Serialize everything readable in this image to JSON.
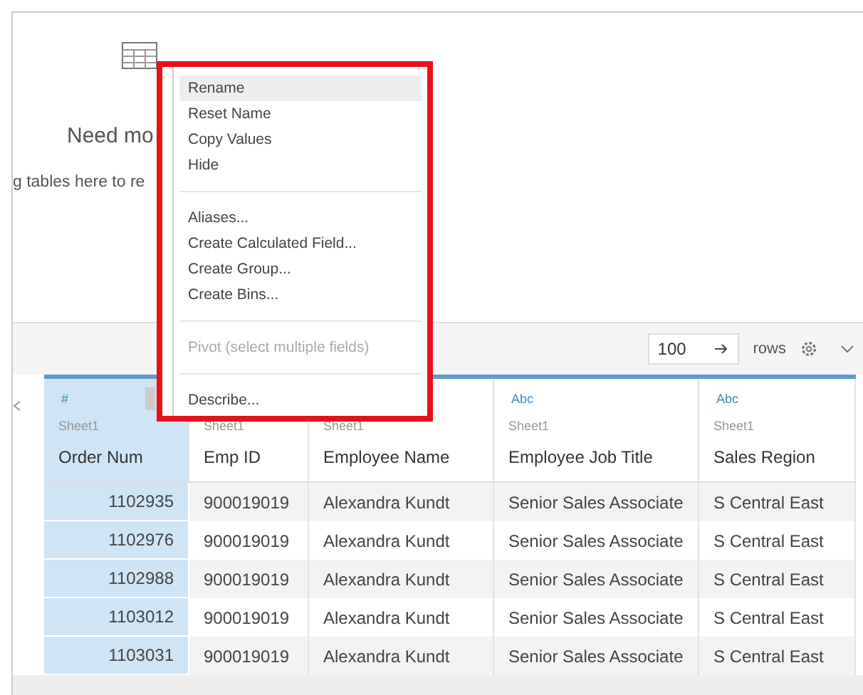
{
  "canvas": {
    "heading": "Need mo",
    "hint": "g tables here to re"
  },
  "toolbar": {
    "rows_value": "100",
    "rows_label": "rows"
  },
  "context_menu": {
    "groups": [
      [
        {
          "label": "Rename",
          "highlighted": true,
          "disabled": false
        },
        {
          "label": "Reset Name",
          "highlighted": false,
          "disabled": false
        },
        {
          "label": "Copy Values",
          "highlighted": false,
          "disabled": false
        },
        {
          "label": "Hide",
          "highlighted": false,
          "disabled": false
        }
      ],
      [
        {
          "label": "Aliases...",
          "highlighted": false,
          "disabled": false
        },
        {
          "label": "Create Calculated Field...",
          "highlighted": false,
          "disabled": false
        },
        {
          "label": "Create Group...",
          "highlighted": false,
          "disabled": false
        },
        {
          "label": "Create Bins...",
          "highlighted": false,
          "disabled": false
        }
      ],
      [
        {
          "label": "Pivot (select multiple fields)",
          "highlighted": false,
          "disabled": true
        }
      ],
      [
        {
          "label": "Describe...",
          "highlighted": false,
          "disabled": false
        }
      ]
    ]
  },
  "table": {
    "columns": [
      {
        "type_icon": "#",
        "source": "Sheet1",
        "name": "Order Num",
        "selected": true,
        "kind": "number"
      },
      {
        "source": "Sheet1",
        "name": "Emp ID",
        "selected": false,
        "kind": "text"
      },
      {
        "source": "Sheet1",
        "name": "Employee Name",
        "selected": false,
        "kind": "text"
      },
      {
        "type_icon": "Abc",
        "source": "Sheet1",
        "name": "Employee Job Title",
        "selected": false,
        "kind": "text"
      },
      {
        "type_icon": "Abc",
        "source": "Sheet1",
        "name": "Sales Region",
        "selected": false,
        "kind": "text"
      }
    ],
    "rows": [
      [
        "1102935",
        "900019019",
        "Alexandra Kundt",
        "Senior Sales Associate",
        "S Central East"
      ],
      [
        "1102976",
        "900019019",
        "Alexandra Kundt",
        "Senior Sales Associate",
        "S Central East"
      ],
      [
        "1102988",
        "900019019",
        "Alexandra Kundt",
        "Senior Sales Associate",
        "S Central East"
      ],
      [
        "1103012",
        "900019019",
        "Alexandra Kundt",
        "Senior Sales Associate",
        "S Central East"
      ],
      [
        "1103031",
        "900019019",
        "Alexandra Kundt",
        "Senior Sales Associate",
        "S Central East"
      ]
    ]
  }
}
